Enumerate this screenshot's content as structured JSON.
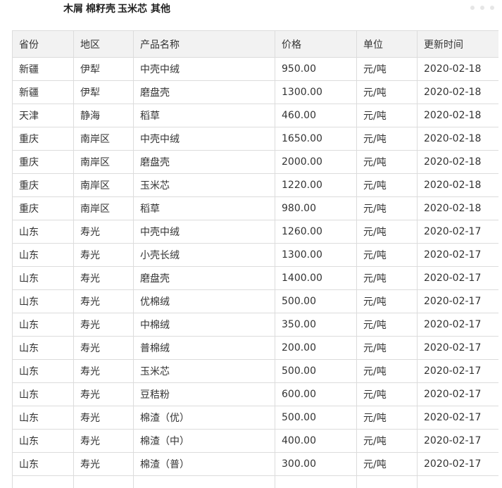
{
  "top_links": [
    "木屑",
    "棉籽壳",
    "玉米芯",
    "其他"
  ],
  "table": {
    "columns": [
      "省份",
      "地区",
      "产品名称",
      "价格",
      "单位",
      "更新时间"
    ],
    "rows": [
      [
        "新疆",
        "伊犁",
        "中壳中绒",
        "950.00",
        "元/吨",
        "2020-02-18"
      ],
      [
        "新疆",
        "伊犁",
        "磨盘壳",
        "1300.00",
        "元/吨",
        "2020-02-18"
      ],
      [
        "天津",
        "静海",
        "稻草",
        "460.00",
        "元/吨",
        "2020-02-18"
      ],
      [
        "重庆",
        "南岸区",
        "中壳中绒",
        "1650.00",
        "元/吨",
        "2020-02-18"
      ],
      [
        "重庆",
        "南岸区",
        "磨盘壳",
        "2000.00",
        "元/吨",
        "2020-02-18"
      ],
      [
        "重庆",
        "南岸区",
        "玉米芯",
        "1220.00",
        "元/吨",
        "2020-02-18"
      ],
      [
        "重庆",
        "南岸区",
        "稻草",
        "980.00",
        "元/吨",
        "2020-02-18"
      ],
      [
        "山东",
        "寿光",
        "中壳中绒",
        "1260.00",
        "元/吨",
        "2020-02-17"
      ],
      [
        "山东",
        "寿光",
        "小壳长绒",
        "1300.00",
        "元/吨",
        "2020-02-17"
      ],
      [
        "山东",
        "寿光",
        "磨盘壳",
        "1400.00",
        "元/吨",
        "2020-02-17"
      ],
      [
        "山东",
        "寿光",
        "优棉绒",
        "500.00",
        "元/吨",
        "2020-02-17"
      ],
      [
        "山东",
        "寿光",
        "中棉绒",
        "350.00",
        "元/吨",
        "2020-02-17"
      ],
      [
        "山东",
        "寿光",
        "普棉绒",
        "200.00",
        "元/吨",
        "2020-02-17"
      ],
      [
        "山东",
        "寿光",
        "玉米芯",
        "500.00",
        "元/吨",
        "2020-02-17"
      ],
      [
        "山东",
        "寿光",
        "豆秸粉",
        "600.00",
        "元/吨",
        "2020-02-17"
      ],
      [
        "山东",
        "寿光",
        "棉渣（优）",
        "500.00",
        "元/吨",
        "2020-02-17"
      ],
      [
        "山东",
        "寿光",
        "棉渣（中）",
        "400.00",
        "元/吨",
        "2020-02-17"
      ],
      [
        "山东",
        "寿光",
        "棉渣（普）",
        "300.00",
        "元/吨",
        "2020-02-17"
      ],
      [
        "",
        "",
        "",
        "",
        "",
        ""
      ]
    ]
  }
}
